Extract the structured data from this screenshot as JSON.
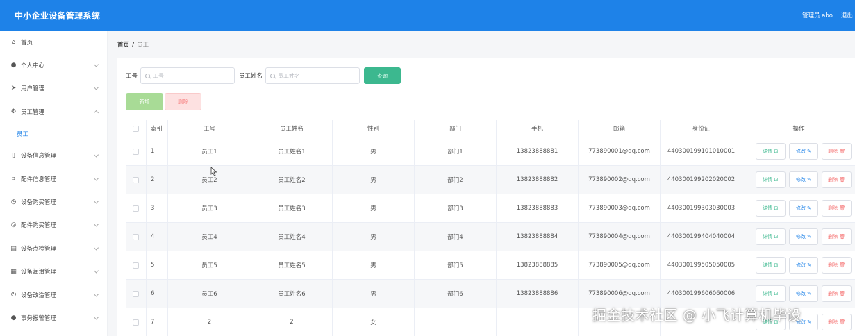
{
  "header": {
    "app_title": "中小企业设备管理系统",
    "user_label": "管理员 abo",
    "logout_label": "退出",
    "bg_color": "#1e82e8"
  },
  "sidebar": {
    "items": [
      {
        "label": "首页",
        "icon": "home-icon",
        "has_chevron": false
      },
      {
        "label": "个人中心",
        "icon": "user-icon",
        "has_chevron": true
      },
      {
        "label": "用户管理",
        "icon": "send-icon",
        "has_chevron": true
      },
      {
        "label": "员工管理",
        "icon": "settings-icon",
        "has_chevron": true,
        "expanded": true,
        "sub": "员工"
      },
      {
        "label": "设备信息管理",
        "icon": "device-icon",
        "has_chevron": true
      },
      {
        "label": "配件信息管理",
        "icon": "crop-icon",
        "has_chevron": true
      },
      {
        "label": "设备购买管理",
        "icon": "clock-icon",
        "has_chevron": true
      },
      {
        "label": "配件购买管理",
        "icon": "target-icon",
        "has_chevron": true
      },
      {
        "label": "设备点检管理",
        "icon": "clipboard-icon",
        "has_chevron": true
      },
      {
        "label": "设备润滑管理",
        "icon": "grid-icon",
        "has_chevron": true
      },
      {
        "label": "设备改造管理",
        "icon": "power-icon",
        "has_chevron": true
      },
      {
        "label": "事务报警管理",
        "icon": "user-icon",
        "has_chevron": true
      }
    ]
  },
  "breadcrumb": {
    "home": "首页",
    "sep": "/",
    "current": "员工"
  },
  "search": {
    "emp_no_label": "工号",
    "emp_no_placeholder": "工号",
    "emp_name_label": "员工姓名",
    "emp_name_placeholder": "员工姓名",
    "search_button": "查询"
  },
  "actions": {
    "add": "新增",
    "delete": "删除"
  },
  "table": {
    "columns": [
      "索引",
      "工号",
      "员工姓名",
      "性别",
      "部门",
      "手机",
      "邮箱",
      "身份证",
      "操作"
    ],
    "op_labels": {
      "detail": "详情 ⊡",
      "edit": "修改 ✎",
      "delete": "删除 🗑"
    },
    "rows": [
      {
        "idx": "1",
        "no": "员工1",
        "name": "员工姓名1",
        "sex": "男",
        "dept": "部门1",
        "phone": "13823888881",
        "email": "773890001@qq.com",
        "id": "440300199101010001"
      },
      {
        "idx": "2",
        "no": "员工2",
        "name": "员工姓名2",
        "sex": "男",
        "dept": "部门2",
        "phone": "13823888882",
        "email": "773890002@qq.com",
        "id": "440300199202020002"
      },
      {
        "idx": "3",
        "no": "员工3",
        "name": "员工姓名3",
        "sex": "男",
        "dept": "部门3",
        "phone": "13823888883",
        "email": "773890003@qq.com",
        "id": "440300199303030003"
      },
      {
        "idx": "4",
        "no": "员工4",
        "name": "员工姓名4",
        "sex": "男",
        "dept": "部门4",
        "phone": "13823888884",
        "email": "773890004@qq.com",
        "id": "440300199404040004"
      },
      {
        "idx": "5",
        "no": "员工5",
        "name": "员工姓名5",
        "sex": "男",
        "dept": "部门5",
        "phone": "13823888885",
        "email": "773890005@qq.com",
        "id": "440300199505050005"
      },
      {
        "idx": "6",
        "no": "员工6",
        "name": "员工姓名6",
        "sex": "男",
        "dept": "部门6",
        "phone": "13823888886",
        "email": "773890006@qq.com",
        "id": "440300199606060006"
      },
      {
        "idx": "7",
        "no": "2",
        "name": "2",
        "sex": "女",
        "dept": "",
        "phone": "",
        "email": "",
        "id": ""
      }
    ]
  },
  "watermark": "掘金技术社区 @ 小飞计算机毕设"
}
